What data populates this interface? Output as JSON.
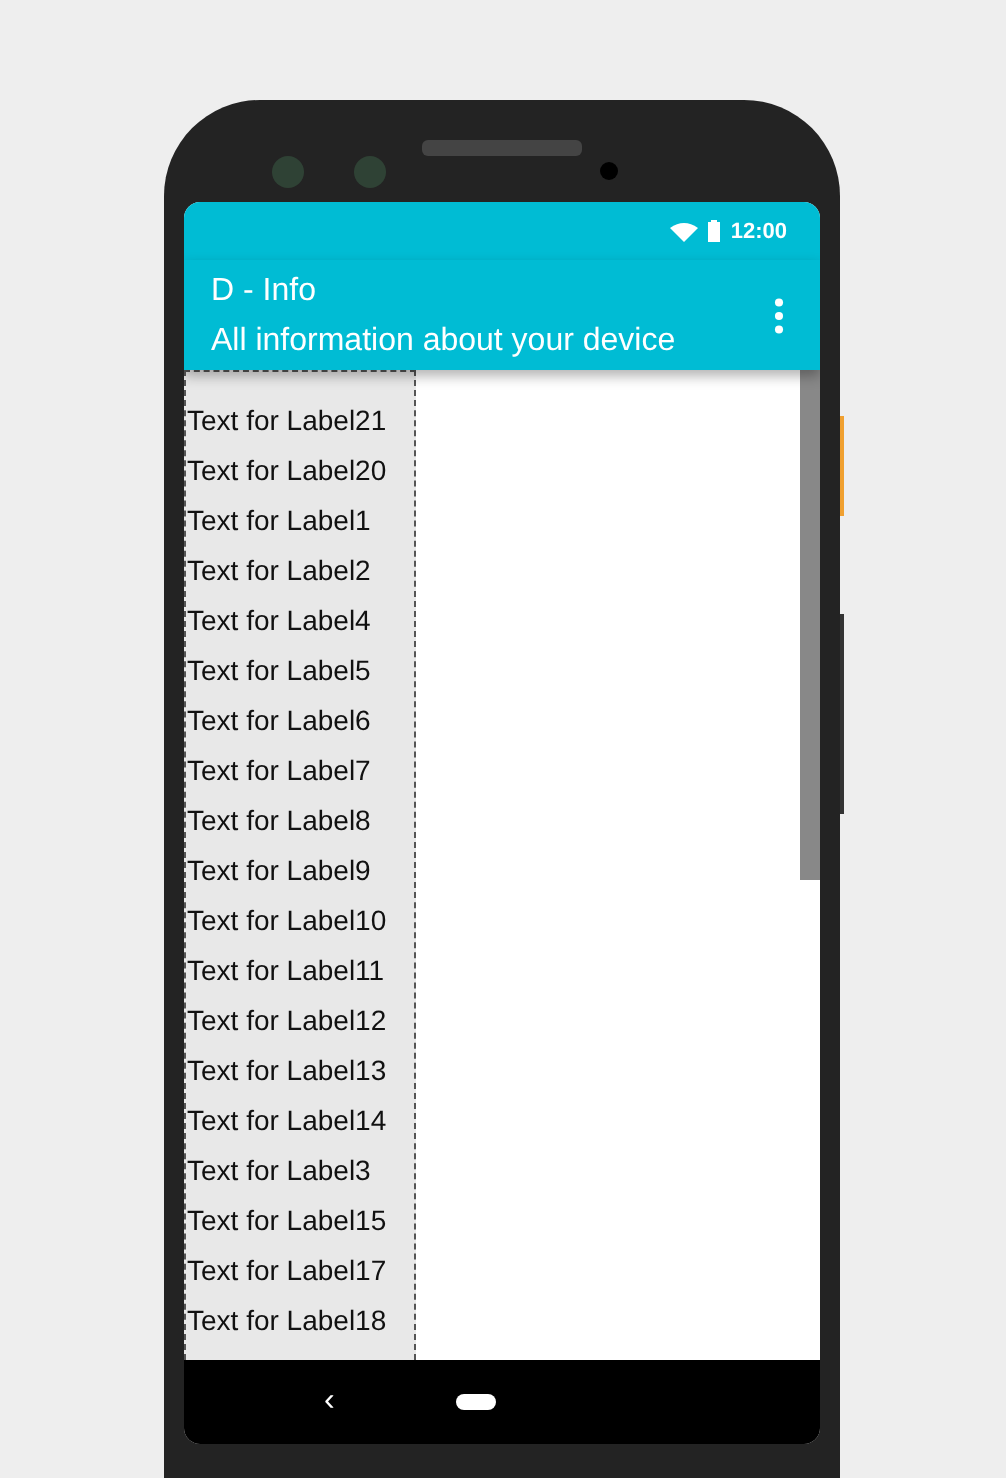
{
  "status_bar": {
    "time": "12:00"
  },
  "app_bar": {
    "title": "D - Info",
    "subtitle": "All information about your device"
  },
  "labels": [
    "Text for Label21",
    "Text for Label20",
    "Text for Label1",
    "Text for Label2",
    "Text for Label4",
    "Text for Label5",
    "Text for Label6",
    "Text for Label7",
    "Text for Label8",
    "Text for Label9",
    "Text for Label10",
    "Text for Label11",
    "Text for Label12",
    "Text for Label13",
    "Text for Label14",
    "Text for Label3",
    "Text for Label15",
    "Text for Label17",
    "Text for Label18"
  ],
  "nav_bar": {
    "back": "‹"
  }
}
